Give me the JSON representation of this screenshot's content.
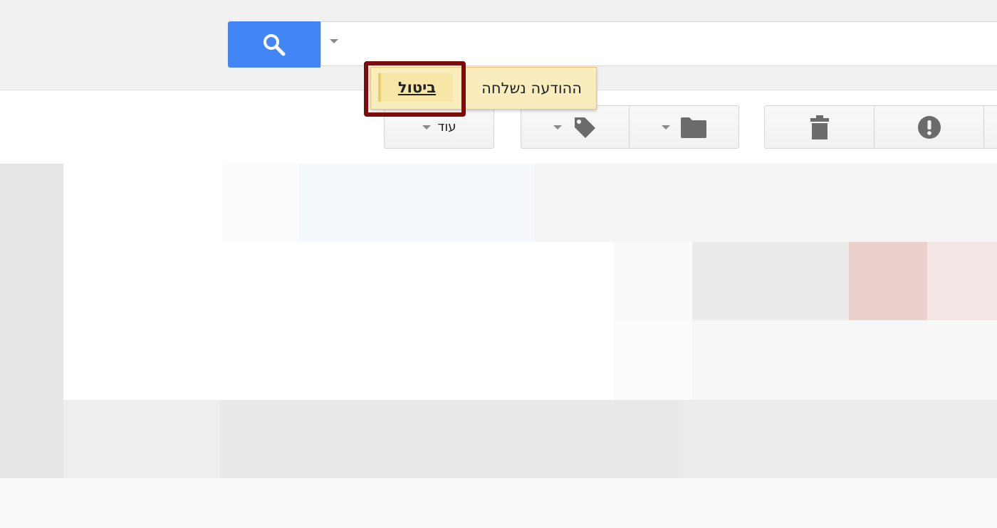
{
  "search": {
    "button_icon": "search-icon",
    "placeholder": "",
    "accent_color": "#4285f4"
  },
  "toast": {
    "message": "ההודעה נשלחה",
    "separator": ".",
    "undo_label": "ביטול",
    "background": "#f9edbe"
  },
  "toolbar": {
    "more_label": "עוד",
    "label_icon": "tag-icon",
    "move_icon": "folder-icon",
    "delete_icon": "trash-icon",
    "spam_icon": "exclamation-icon"
  }
}
